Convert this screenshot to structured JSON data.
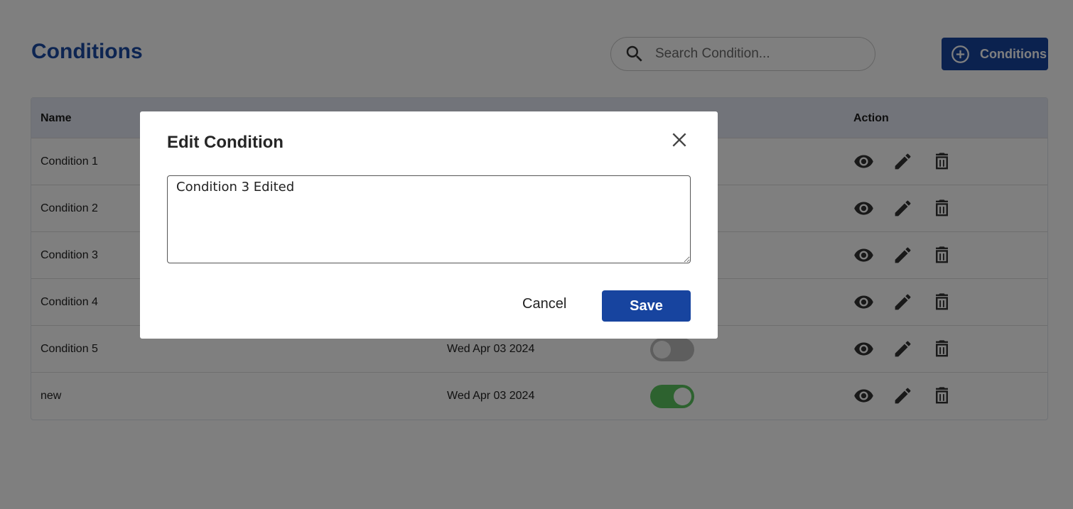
{
  "page": {
    "title": "Conditions",
    "search_placeholder": "Search Condition...",
    "add_button_label": "Conditions"
  },
  "table": {
    "headers": {
      "name": "Name",
      "action": "Action"
    },
    "rows": [
      {
        "name": "Condition 1",
        "date": "",
        "toggle": ""
      },
      {
        "name": "Condition 2",
        "date": "",
        "toggle": ""
      },
      {
        "name": "Condition 3",
        "date": "",
        "toggle": ""
      },
      {
        "name": "Condition 4",
        "date": "",
        "toggle": ""
      },
      {
        "name": "Condition 5",
        "date": "Wed Apr 03 2024",
        "toggle": "off"
      },
      {
        "name": "new",
        "date": "Wed Apr 03 2024",
        "toggle": "on"
      }
    ],
    "action_icons": [
      "eye-icon",
      "pencil-icon",
      "trash-icon"
    ]
  },
  "modal": {
    "title": "Edit Condition",
    "textarea_value": "Condition 3 Edited",
    "cancel_label": "Cancel",
    "save_label": "Save"
  },
  "colors": {
    "brand_blue": "#17449f",
    "title_blue": "#1a4aa5",
    "toggle_on": "#5ac45e",
    "toggle_off": "#bdbdbd"
  }
}
